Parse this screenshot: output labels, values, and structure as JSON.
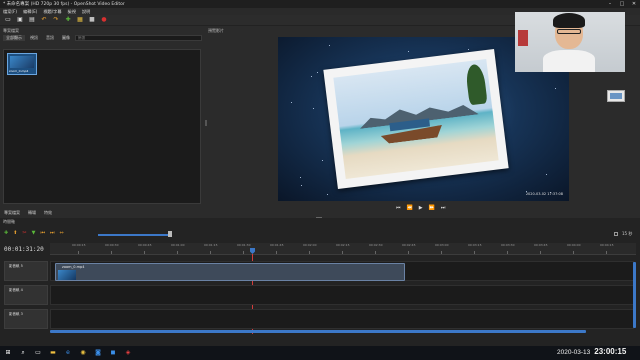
{
  "window": {
    "title": "* 未命名專案 (HD 720p 30 fps) - OpenShot Video Editor",
    "minimize": "–",
    "maximize": "□",
    "close": "✕"
  },
  "menu": {
    "items": [
      "檔案(F)",
      "編輯(E)",
      "標題/字幕",
      "檢視",
      "說明"
    ]
  },
  "toolbar": {
    "icons": [
      {
        "name": "new-project-icon",
        "glyph": "▭",
        "color": "#e8e8e8"
      },
      {
        "name": "open-project-icon",
        "glyph": "▣",
        "color": "#e0e0e0"
      },
      {
        "name": "save-project-icon",
        "glyph": "▤",
        "color": "#e0e0e0"
      },
      {
        "name": "undo-icon",
        "glyph": "↶",
        "color": "#e8a030"
      },
      {
        "name": "redo-icon",
        "glyph": "↷",
        "color": "#e8a030"
      },
      {
        "name": "import-files-icon",
        "glyph": "✚",
        "color": "#5ab83a"
      },
      {
        "name": "profile-icon",
        "glyph": "▦",
        "color": "#e8c040"
      },
      {
        "name": "fullscreen-icon",
        "glyph": "■",
        "color": "#c0c0c0"
      },
      {
        "name": "export-video-icon",
        "glyph": "●",
        "color": "#d83030"
      }
    ]
  },
  "project_files": {
    "title": "專案檔案",
    "filter_tabs": [
      "全部顯示",
      "視訊",
      "音訊",
      "圖像"
    ],
    "filter_placeholder": "篩選",
    "file_label": "zoom_0.mp4"
  },
  "preview": {
    "title": "預覽影片",
    "timestamp": "2020-03-02 17:37:08"
  },
  "playback": {
    "jump_start": "⏮",
    "rewind": "⏪",
    "play": "▶",
    "fast_forward": "⏩",
    "jump_end": "⏭"
  },
  "bottom_tabs": [
    "專案檔案",
    "轉場",
    "特效"
  ],
  "timeline": {
    "title": "時間軸",
    "current_time": "00:01:31:20",
    "zoom_label": "15 秒",
    "ruler_ticks": [
      "00:00:15",
      "00:00:30",
      "00:00:45",
      "00:01:00",
      "00:01:15",
      "00:01:30",
      "00:01:45",
      "00:02:00",
      "00:02:15",
      "00:02:30",
      "00:02:45",
      "00:03:00",
      "00:03:15",
      "00:03:30",
      "00:03:45",
      "00:04:00",
      "00:04:15"
    ],
    "tracks": [
      {
        "label": "影音軌 5",
        "clip": "zoom_0.mp4"
      },
      {
        "label": "影音軌 4",
        "clip": ""
      },
      {
        "label": "影音軌 3",
        "clip": ""
      }
    ],
    "tool_icons": [
      {
        "name": "add-track-icon",
        "glyph": "✚",
        "color": "#5ab83a"
      },
      {
        "name": "snapping-icon",
        "glyph": "⬆",
        "color": "#e8a030"
      },
      {
        "name": "razor-icon",
        "glyph": "✂",
        "color": "#d83030"
      },
      {
        "name": "add-marker-icon",
        "glyph": "▼",
        "color": "#5ab83a"
      },
      {
        "name": "previous-marker-icon",
        "glyph": "⏮",
        "color": "#e8a030"
      },
      {
        "name": "next-marker-icon",
        "glyph": "⏭",
        "color": "#e8a030"
      },
      {
        "name": "center-timeline-icon",
        "glyph": "⇔",
        "color": "#e8a030"
      }
    ]
  },
  "taskbar": {
    "icons": [
      {
        "name": "start-icon",
        "glyph": "⊞",
        "color": "#ffffff"
      },
      {
        "name": "taskbar-search-icon",
        "glyph": "⌕",
        "color": "#ffffff"
      },
      {
        "name": "task-view-icon",
        "glyph": "▭",
        "color": "#ffffff"
      },
      {
        "name": "file-explorer-icon",
        "glyph": "▬",
        "color": "#f0c040"
      },
      {
        "name": "edge-icon",
        "glyph": "e",
        "color": "#3a8ee8"
      },
      {
        "name": "chrome-icon",
        "glyph": "◉",
        "color": "#e8c040"
      },
      {
        "name": "zoom-app-icon",
        "glyph": "◙",
        "color": "#3a8ee8"
      },
      {
        "name": "camera-icon",
        "glyph": "◼",
        "color": "#3a8ee8"
      },
      {
        "name": "openshot-taskbar-icon",
        "glyph": "◈",
        "color": "#e84040"
      }
    ],
    "date": "2020-03-13",
    "time": "23:00:15"
  }
}
